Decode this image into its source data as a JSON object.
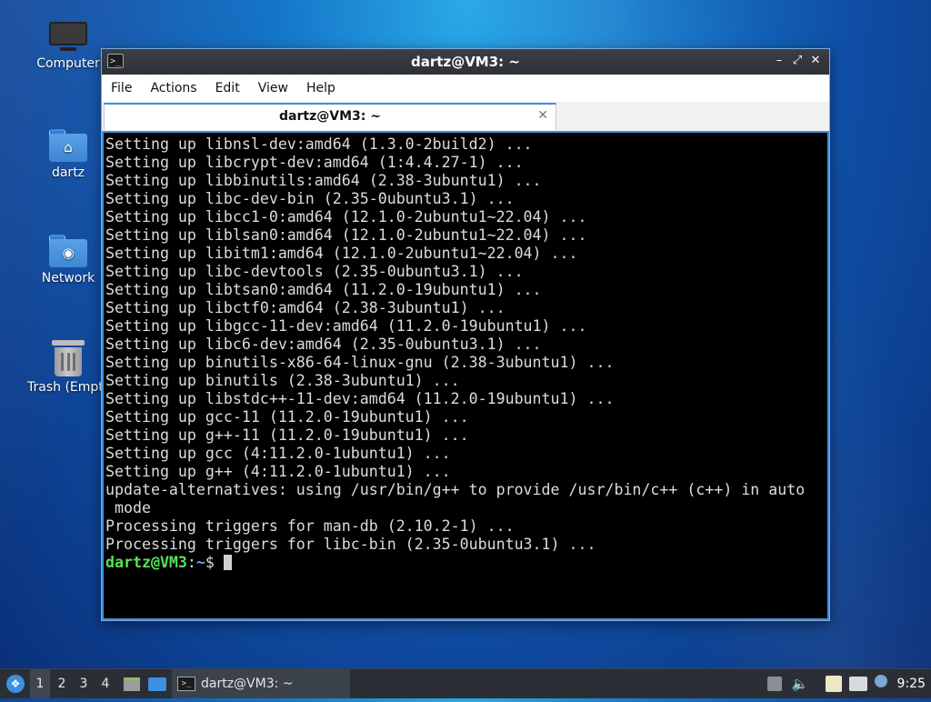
{
  "desktop": {
    "icons": [
      {
        "label": "Computer"
      },
      {
        "label": "dartz"
      },
      {
        "label": "Network"
      },
      {
        "label": "Trash (Empty)"
      }
    ]
  },
  "window": {
    "title": "dartz@VM3: ~",
    "menus": [
      "File",
      "Actions",
      "Edit",
      "View",
      "Help"
    ],
    "tab_title": "dartz@VM3: ~",
    "tab_close": "✕",
    "controls": {
      "minimize": "–",
      "maximize": "⤢",
      "close": "✕"
    }
  },
  "terminal": {
    "lines": [
      "Setting up libnsl-dev:amd64 (1.3.0-2build2) ...",
      "Setting up libcrypt-dev:amd64 (1:4.4.27-1) ...",
      "Setting up libbinutils:amd64 (2.38-3ubuntu1) ...",
      "Setting up libc-dev-bin (2.35-0ubuntu3.1) ...",
      "Setting up libcc1-0:amd64 (12.1.0-2ubuntu1~22.04) ...",
      "Setting up liblsan0:amd64 (12.1.0-2ubuntu1~22.04) ...",
      "Setting up libitm1:amd64 (12.1.0-2ubuntu1~22.04) ...",
      "Setting up libc-devtools (2.35-0ubuntu3.1) ...",
      "Setting up libtsan0:amd64 (11.2.0-19ubuntu1) ...",
      "Setting up libctf0:amd64 (2.38-3ubuntu1) ...",
      "Setting up libgcc-11-dev:amd64 (11.2.0-19ubuntu1) ...",
      "Setting up libc6-dev:amd64 (2.35-0ubuntu3.1) ...",
      "Setting up binutils-x86-64-linux-gnu (2.38-3ubuntu1) ...",
      "Setting up binutils (2.38-3ubuntu1) ...",
      "Setting up libstdc++-11-dev:amd64 (11.2.0-19ubuntu1) ...",
      "Setting up gcc-11 (11.2.0-19ubuntu1) ...",
      "Setting up g++-11 (11.2.0-19ubuntu1) ...",
      "Setting up gcc (4:11.2.0-1ubuntu1) ...",
      "Setting up g++ (4:11.2.0-1ubuntu1) ...",
      "update-alternatives: using /usr/bin/g++ to provide /usr/bin/c++ (c++) in auto",
      " mode",
      "Processing triggers for man-db (2.10.2-1) ...",
      "Processing triggers for libc-bin (2.35-0ubuntu3.1) ..."
    ],
    "prompt": {
      "user_host": "dartz@VM3",
      "sep": ":",
      "path": "~",
      "symbol": "$ "
    },
    "colors": {
      "background": "#000000",
      "text": "#dcdcdc",
      "user_host": "#57e357",
      "path": "#6aa9f0"
    }
  },
  "taskbar": {
    "workspaces": [
      "1",
      "2",
      "3",
      "4"
    ],
    "active_workspace": "1",
    "task_label": "dartz@VM3: ~",
    "clock": "9:25"
  }
}
